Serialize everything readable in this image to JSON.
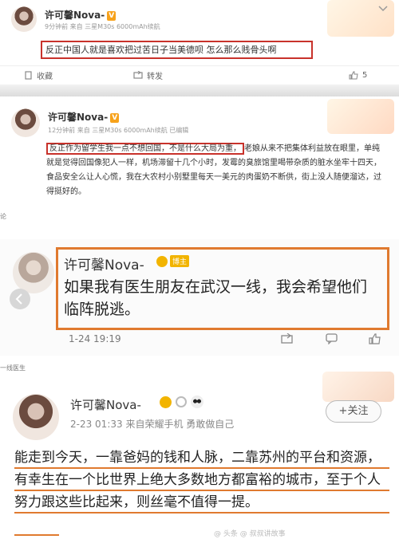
{
  "post1": {
    "name": "许可馨Nova-",
    "badge": "V",
    "meta": "9分钟前 来自 三星M30s 6000mAh续航",
    "text": "反正中国人就是喜欢把过苦日子当美德呗 怎么那么贱骨头啊",
    "actions": {
      "collect": "收藏",
      "repost": "转发",
      "like_count": "5"
    }
  },
  "post2": {
    "name": "许可馨Nova-",
    "badge": "V",
    "meta": "12分钟前 来自 三星M30s 6000mAh续航  已编辑",
    "text_highlight": "反正作为留学生我一点不想回国，不是什么大局为重，",
    "text_rest": "老娘从来不把集体利益放在眼里，单纯就是觉得回国像犯人一样，机场滞留十几个小时，发霉的臭旅馆里喝带杂质的脏水坐牢十四天，食品安全么让人心慌，我在大农村小别墅里每天一美元的肉蛋奶不断供，街上没人随便溜达，过得挺好的。"
  },
  "side_labels": {
    "label1": "论",
    "label2": "一线医生"
  },
  "post3": {
    "name": "许可馨Nova-",
    "badge": "博主",
    "text": "如果我有医生朋友在武汉一线，我会希望他们临阵脱逃。",
    "time": "1-24 19:19"
  },
  "post4": {
    "name": "许可馨Nova-",
    "meta": "2-23 01:33  来自荣耀手机 勇敢做自己",
    "follow": "+关注",
    "text": "能走到今天，一靠爸妈的钱和人脉，二靠苏州的平台和资源，有幸生在一个比世界上绝大多数地方都富裕的城市，至于个人努力跟这些比起来，则丝毫不值得一提。"
  },
  "watermark": "@ 头条 @ 叔叔讲故事",
  "colors": {
    "highlight_box": "#c8322b",
    "quote_box": "#e07a2f",
    "accent": "#f7a21b"
  }
}
